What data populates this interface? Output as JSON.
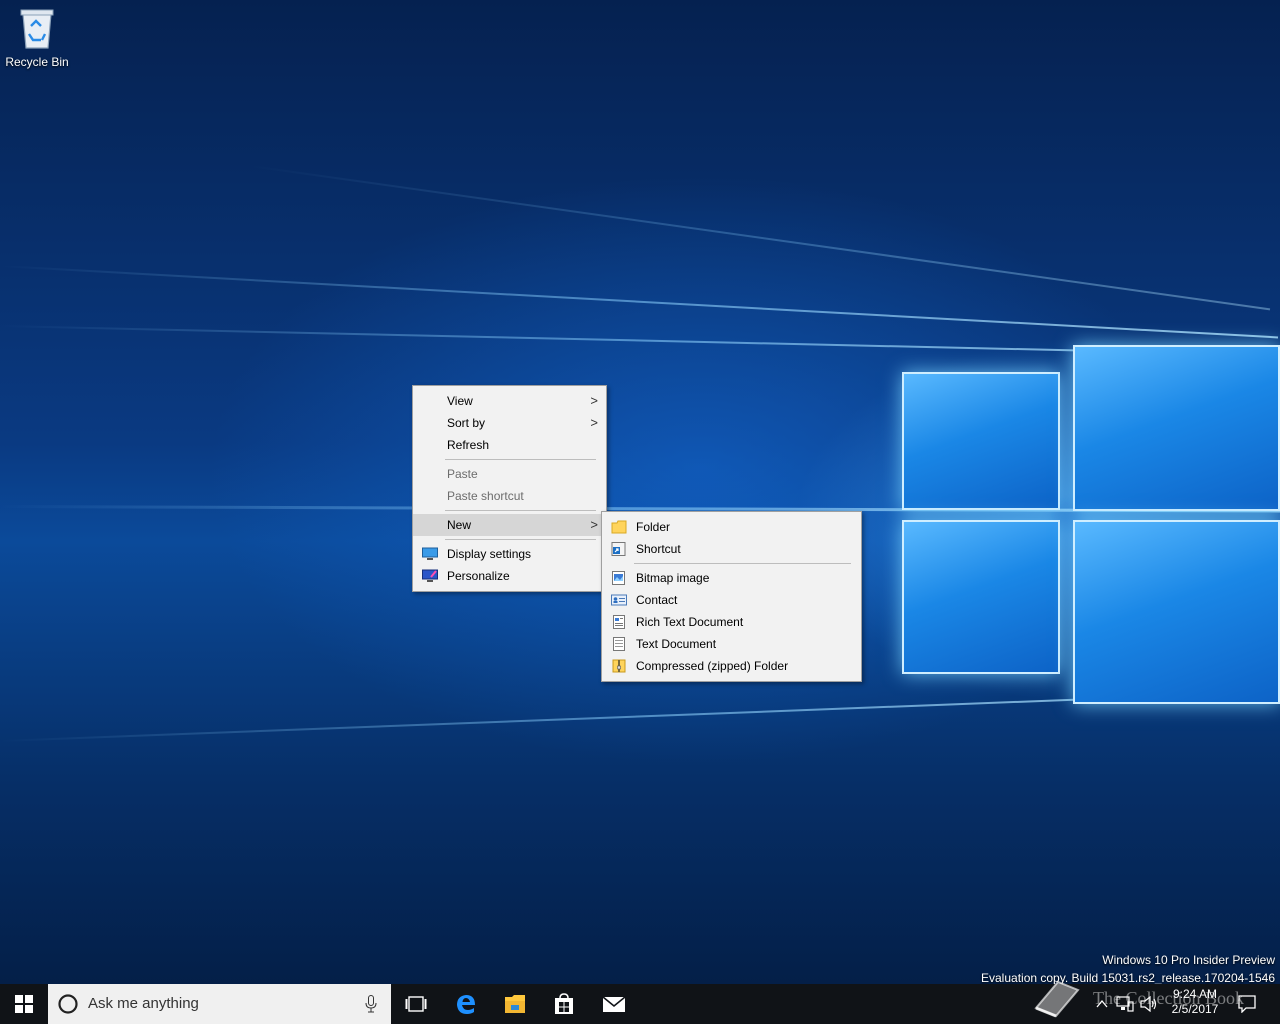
{
  "desktop": {
    "icons": [
      {
        "label": "Recycle Bin",
        "icon": "recycle-bin-icon"
      }
    ]
  },
  "context_menu": {
    "items": [
      {
        "label": "View",
        "submenu": true
      },
      {
        "label": "Sort by",
        "submenu": true
      },
      {
        "label": "Refresh"
      },
      {
        "label": "Paste",
        "disabled": true
      },
      {
        "label": "Paste shortcut",
        "disabled": true
      },
      {
        "label": "New",
        "submenu": true,
        "highlighted": true
      },
      {
        "label": "Display settings",
        "icon": "display-settings-icon"
      },
      {
        "label": "Personalize",
        "icon": "personalize-icon"
      }
    ],
    "arrow_glyph": ">"
  },
  "new_submenu": {
    "items": [
      {
        "label": "Folder",
        "icon": "folder-icon"
      },
      {
        "label": "Shortcut",
        "icon": "shortcut-icon"
      },
      {
        "label": "Bitmap image",
        "icon": "bitmap-image-icon"
      },
      {
        "label": "Contact",
        "icon": "contact-icon"
      },
      {
        "label": "Rich Text Document",
        "icon": "rich-text-document-icon"
      },
      {
        "label": "Text Document",
        "icon": "text-document-icon"
      },
      {
        "label": "Compressed (zipped) Folder",
        "icon": "zip-folder-icon"
      }
    ]
  },
  "watermark": {
    "line1": "Windows 10 Pro Insider Preview",
    "line2": "Evaluation copy. Build 15031.rs2_release.170204-1546",
    "brand": "The Collection Book"
  },
  "taskbar": {
    "search_placeholder": "Ask me anything",
    "clock_time": "9:24 AM",
    "clock_date": "2/5/2017",
    "colors": {
      "taskbar": "#101317",
      "search_box": "#f0f0f0",
      "accent": "#0078d7"
    }
  }
}
